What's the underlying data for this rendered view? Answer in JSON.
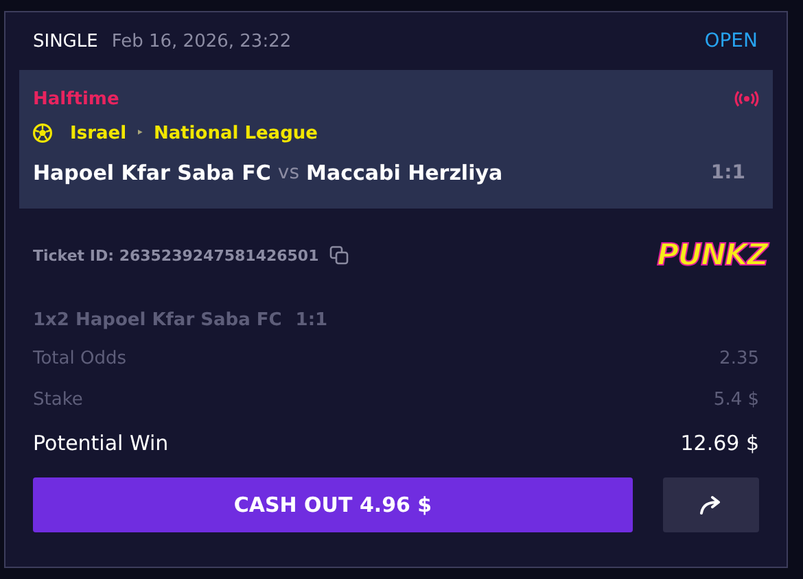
{
  "header": {
    "type": "SINGLE",
    "date": "Feb 16, 2026, 23:22",
    "status": "OPEN"
  },
  "match": {
    "phase": "Halftime",
    "live": true,
    "country": "Israel",
    "separator": "‣",
    "league": "National League",
    "home": "Hapoel Kfar Saba FC",
    "vs": "vs",
    "away": "Maccabi Herzliya",
    "score": "1:1"
  },
  "ticket": {
    "label": "Ticket ID: 2635239247581426501",
    "logo": "PUNKZ"
  },
  "selection": {
    "market": "1x2 Hapoel Kfar Saba FC",
    "pick": "1:1"
  },
  "rows": [
    {
      "label": "Total Odds",
      "value": "2.35",
      "kind": "plain"
    },
    {
      "label": "Stake",
      "value": "5.4 $",
      "kind": "plain"
    },
    {
      "label": "Potential Win",
      "value": "12.69 $",
      "kind": "highlight"
    }
  ],
  "cashout": {
    "label": "CASH OUT 4.96 $"
  }
}
